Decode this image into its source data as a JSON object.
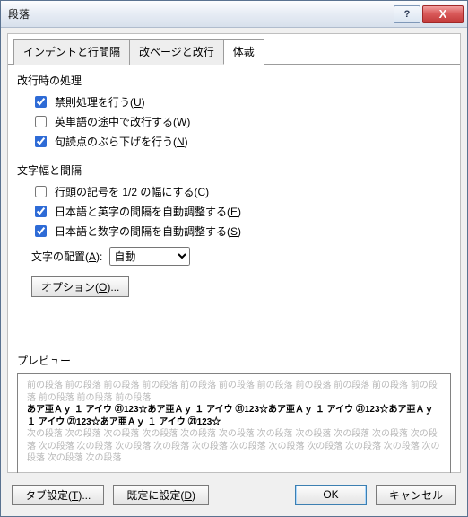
{
  "window": {
    "title": "段落"
  },
  "titlebar_buttons": {
    "help": "?",
    "close": "X"
  },
  "tabs": {
    "indent": "インデントと行間隔",
    "page": "改ページと改行",
    "style": "体裁"
  },
  "group1": {
    "label": "改行時の処理",
    "opt1": {
      "text": "禁則処理を行う(",
      "accel": "U",
      "suffix": ")",
      "checked": true
    },
    "opt2": {
      "text": "英単語の途中で改行する(",
      "accel": "W",
      "suffix": ")",
      "checked": false
    },
    "opt3": {
      "text": "句読点のぶら下げを行う(",
      "accel": "N",
      "suffix": ")",
      "checked": true
    }
  },
  "group2": {
    "label": "文字幅と間隔",
    "opt1": {
      "text": "行頭の記号を 1/2 の幅にする(",
      "accel": "C",
      "suffix": ")",
      "checked": false
    },
    "opt2": {
      "text": "日本語と英字の間隔を自動調整する(",
      "accel": "E",
      "suffix": ")",
      "checked": true
    },
    "opt3": {
      "text": "日本語と数字の間隔を自動調整する(",
      "accel": "S",
      "suffix": ")",
      "checked": true
    },
    "align_label": {
      "text": "文字の配置(",
      "accel": "A",
      "suffix": "):"
    },
    "align_value": "自動"
  },
  "options_button": {
    "text": "オプション(",
    "accel": "O",
    "suffix": ")..."
  },
  "preview": {
    "label": "プレビュー",
    "prev_para": "前の段落 前の段落 前の段落 前の段落 前の段落 前の段落 前の段落 前の段落 前の段落 前の段落 前の段落 前の段落 前の段落 前の段落",
    "sample": "あア亜Ａｙ １ アイウ ㉑123☆あア亜Ａｙ １ アイウ ㉑123☆あア亜Ａｙ １ アイウ ㉑123☆あア亜Ａｙ １ アイウ ㉑123☆あア亜Ａｙ １ アイウ ㉑123☆",
    "next_para": "次の段落 次の段落 次の段落 次の段落 次の段落 次の段落 次の段落 次の段落 次の段落 次の段落 次の段落 次の段落 次の段落 次の段落 次の段落 次の段落 次の段落 次の段落 次の段落 次の段落 次の段落 次の段落 次の段落 次の段落"
  },
  "footer": {
    "tabs": {
      "text": "タブ設定(",
      "accel": "T",
      "suffix": ")..."
    },
    "defaults": {
      "text": "既定に設定(",
      "accel": "D",
      "suffix": ")"
    },
    "ok": "OK",
    "cancel": "キャンセル"
  }
}
